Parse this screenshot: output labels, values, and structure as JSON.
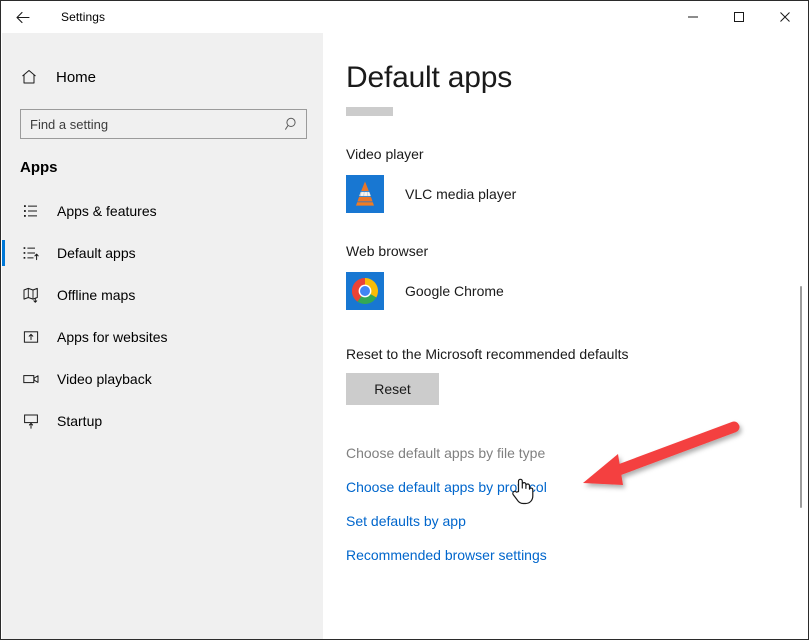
{
  "window": {
    "title": "Settings",
    "back_icon": "back-arrow-icon",
    "controls": {
      "minimize": "minimize-icon",
      "maximize": "maximize-icon",
      "close": "close-icon"
    }
  },
  "sidebar": {
    "home": {
      "label": "Home",
      "icon": "home-icon"
    },
    "search": {
      "placeholder": "Find a setting",
      "value": "",
      "icon": "search-icon"
    },
    "section_title": "Apps",
    "items": [
      {
        "label": "Apps & features",
        "icon": "list-icon",
        "selected": false
      },
      {
        "label": "Default apps",
        "icon": "default-apps-icon",
        "selected": true
      },
      {
        "label": "Offline maps",
        "icon": "map-download-icon",
        "selected": false
      },
      {
        "label": "Apps for websites",
        "icon": "app-website-icon",
        "selected": false
      },
      {
        "label": "Video playback",
        "icon": "video-camera-icon",
        "selected": false
      },
      {
        "label": "Startup",
        "icon": "startup-icon",
        "selected": false
      }
    ]
  },
  "main": {
    "title": "Default apps",
    "redacted_bar": "",
    "groups": [
      {
        "label": "Video player",
        "app_name": "VLC media player",
        "app_icon": "vlc-icon"
      },
      {
        "label": "Web browser",
        "app_name": "Google Chrome",
        "app_icon": "chrome-icon"
      }
    ],
    "reset_section": {
      "label": "Reset to the Microsoft recommended defaults",
      "button_label": "Reset"
    },
    "links": [
      {
        "label": "Choose default apps by file type",
        "state": "visited"
      },
      {
        "label": "Choose default apps by protocol",
        "state": "normal"
      },
      {
        "label": "Set defaults by app",
        "state": "normal"
      },
      {
        "label": "Recommended browser settings",
        "state": "normal"
      }
    ]
  },
  "colors": {
    "accent": "#0078d7",
    "link": "#0066cc",
    "link_visited": "#808080",
    "sidebar_bg": "#f0f0f0",
    "annotation_arrow": "#f43f3f",
    "icon_tile_bg": "#1877d2"
  },
  "annotation": {
    "arrow": "red-arrow-annotation",
    "cursor": "hand-cursor"
  }
}
